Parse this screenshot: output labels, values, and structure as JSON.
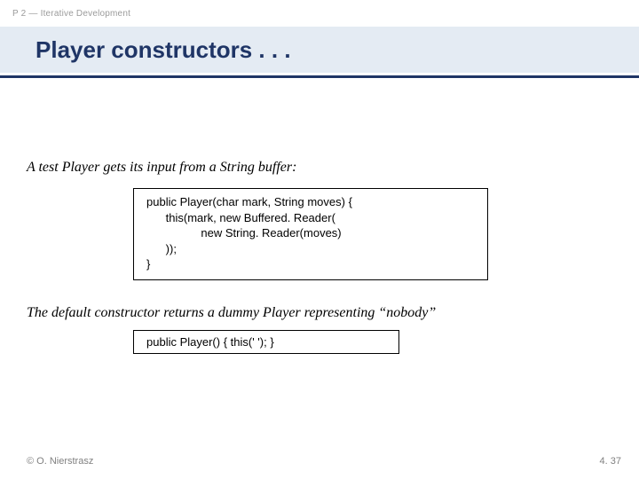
{
  "header": {
    "topic": "P 2 — Iterative Development",
    "title": "Player constructors . . ."
  },
  "body": {
    "lead1": "A test Player gets its input from a String buffer:",
    "code1": "public Player(char mark, String moves) {\n      this(mark, new Buffered. Reader(\n                 new String. Reader(moves)\n      ));\n}",
    "lead2": "The default constructor returns a dummy Player representing “nobody”",
    "code2": "public Player() { this(' '); }"
  },
  "footer": {
    "left": "© O. Nierstrasz",
    "right": "4. 37"
  }
}
